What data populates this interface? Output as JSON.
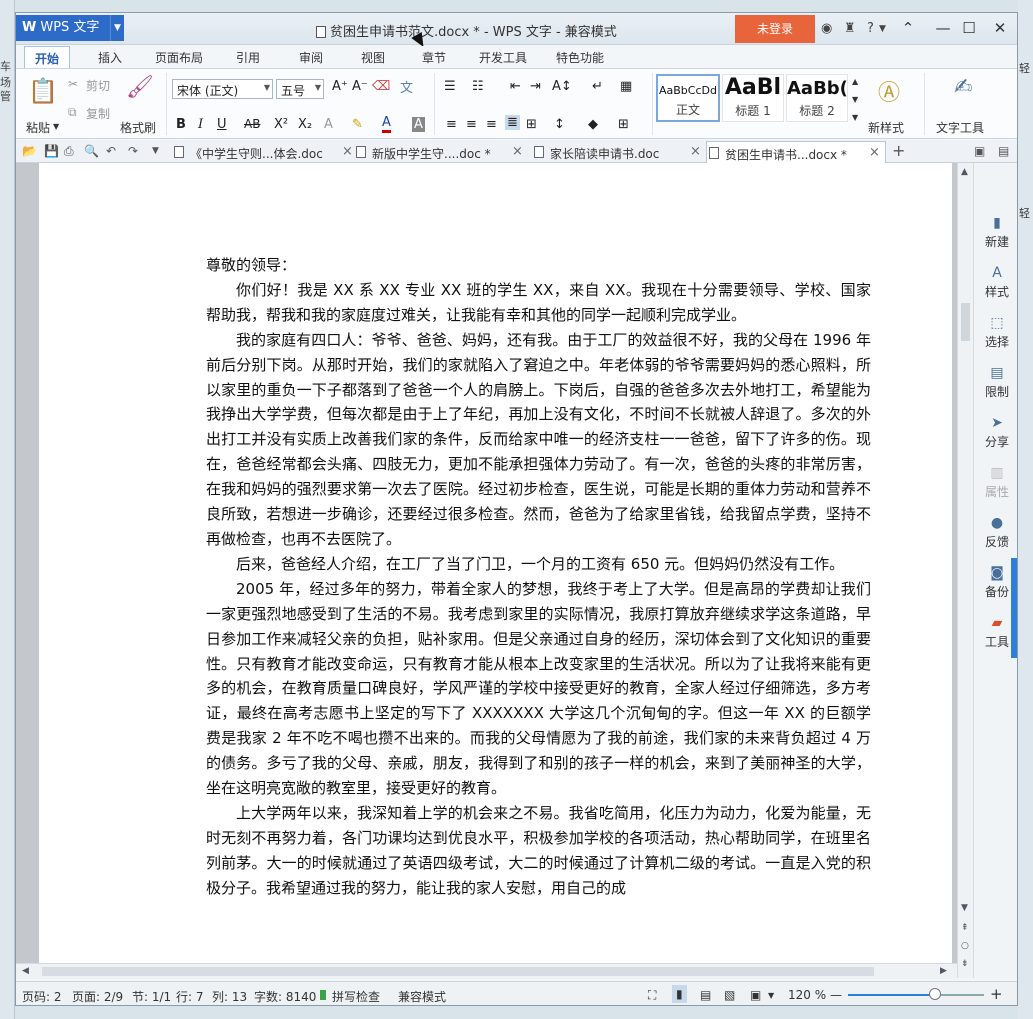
{
  "desktop": {
    "left_labels": [
      "车场",
      "管"
    ],
    "right_labels": [
      "轻",
      "轻"
    ]
  },
  "titlebar": {
    "app_name": "WPS 文字",
    "doc_title": "贫困生申请书范文.docx * - WPS 文字 - 兼容模式",
    "login_label": "未登录",
    "help_label": "?"
  },
  "ribbon_tabs": [
    "开始",
    "插入",
    "页面布局",
    "引用",
    "审阅",
    "视图",
    "章节",
    "开发工具",
    "特色功能"
  ],
  "ribbon": {
    "paste_label": "粘贴",
    "cut_label": "剪切",
    "copy_label": "复制",
    "format_painter_label": "格式刷",
    "font_name": "宋体 (正文)",
    "font_size": "五号",
    "bold": "B",
    "italic": "I",
    "underline": "U",
    "strike": "AB",
    "superscript": "X²",
    "subscript": "X₂",
    "styles": [
      {
        "preview": "AaBbCcDd",
        "label": "正文"
      },
      {
        "preview": "AaBl",
        "label": "标题 1"
      },
      {
        "preview": "AaBb(",
        "label": "标题 2"
      }
    ],
    "new_style_label": "新样式",
    "text_tools_label": "文字工具"
  },
  "doc_tabs": [
    {
      "label": "《中学生守则...体会.doc",
      "active": false
    },
    {
      "label": "新版中学生守....doc *",
      "active": false
    },
    {
      "label": "家长陪读申请书.doc",
      "active": false
    },
    {
      "label": "贫困生申请书...docx *",
      "active": true
    }
  ],
  "document": {
    "paragraphs": [
      {
        "indent": false,
        "text": "尊敬的领导："
      },
      {
        "indent": true,
        "text": "你们好！我是 XX 系 XX 专业 XX 班的学生 XX，来自 XX。我现在十分需要领导、学校、国家帮助我，帮我和我的家庭度过难关，让我能有幸和其他的同学一起顺利完成学业。"
      },
      {
        "indent": true,
        "text": "我的家庭有四口人：爷爷、爸爸、妈妈，还有我。由于工厂的效益很不好，我的父母在 1996 年前后分别下岗。从那时开始，我们的家就陷入了窘迫之中。年老体弱的爷爷需要妈妈的悉心照料，所以家里的重负一下子都落到了爸爸一个人的肩膀上。下岗后，自强的爸爸多次去外地打工，希望能为我挣出大学学费，但每次都是由于上了年纪，再加上没有文化，不时间不长就被人辞退了。多次的外出打工并没有实质上改善我们家的条件，反而给家中唯一的经济支柱一一爸爸，留下了许多的伤。现在，爸爸经常都会头痛、四肢无力，更加不能承担强体力劳动了。有一次，爸爸的头疼的非常厉害，在我和妈妈的强烈要求第一次去了医院。经过初步检查，医生说，可能是长期的重体力劳动和营养不良所致，若想进一步确诊，还要经过很多检查。然而，爸爸为了给家里省钱，给我留点学费，坚持不再做检查，也再不去医院了。"
      },
      {
        "indent": true,
        "text": "后来，爸爸经人介绍，在工厂了当了门卫，一个月的工资有 650 元。但妈妈仍然没有工作。"
      },
      {
        "indent": true,
        "text": "2005 年，经过多年的努力，带着全家人的梦想，我终于考上了大学。但是高昂的学费却让我们一家更强烈地感受到了生活的不易。我考虑到家里的实际情况，我原打算放弃继续求学这条道路，早日参加工作来减轻父亲的负担，贴补家用。但是父亲通过自身的经历，深切体会到了文化知识的重要性。只有教育才能改变命运，只有教育才能从根本上改变家里的生活状况。所以为了让我将来能有更多的机会，在教育质量口碑良好，学风严谨的学校中接受更好的教育，全家人经过仔细筛选，多方考证，最终在高考志愿书上坚定的写下了 XXXXXXX 大学这几个沉甸甸的字。但这一年 XX 的巨额学费是我家 2 年不吃不喝也攒不出来的。而我的父母情愿为了我的前途，我们家的未来背负超过 4 万的债务。多亏了我的父母、亲戚，朋友，我得到了和别的孩子一样的机会，来到了美丽神圣的大学，坐在这明亮宽敞的教室里，接受更好的教育。"
      },
      {
        "indent": true,
        "text": "上大学两年以来，我深知着上学的机会来之不易。我省吃简用，化压力为动力，化爱为能量，无时无刻不再努力着，各门功课均达到优良水平，积极参加学校的各项活动，热心帮助同学，在班里名列前茅。大一的时候就通过了英语四级考试，大二的时候通过了计算机二级的考试。一直是入党的积极分子。我希望通过我的努力，能让我的家人安慰，用自己的成"
      }
    ]
  },
  "sidebar": [
    "新建",
    "样式",
    "选择",
    "限制",
    "分享",
    "属性",
    "反馈",
    "备份",
    "工具"
  ],
  "status": {
    "page_no": "页码: 2",
    "pages": "页面: 2/9",
    "section": "节: 1/1",
    "row": "行: 7",
    "col": "列: 13",
    "word_count": "字数: 8140",
    "spell_check": "拼写检查",
    "compat_mode": "兼容模式",
    "zoom": "120 %",
    "zoom_fraction": 0.64
  }
}
